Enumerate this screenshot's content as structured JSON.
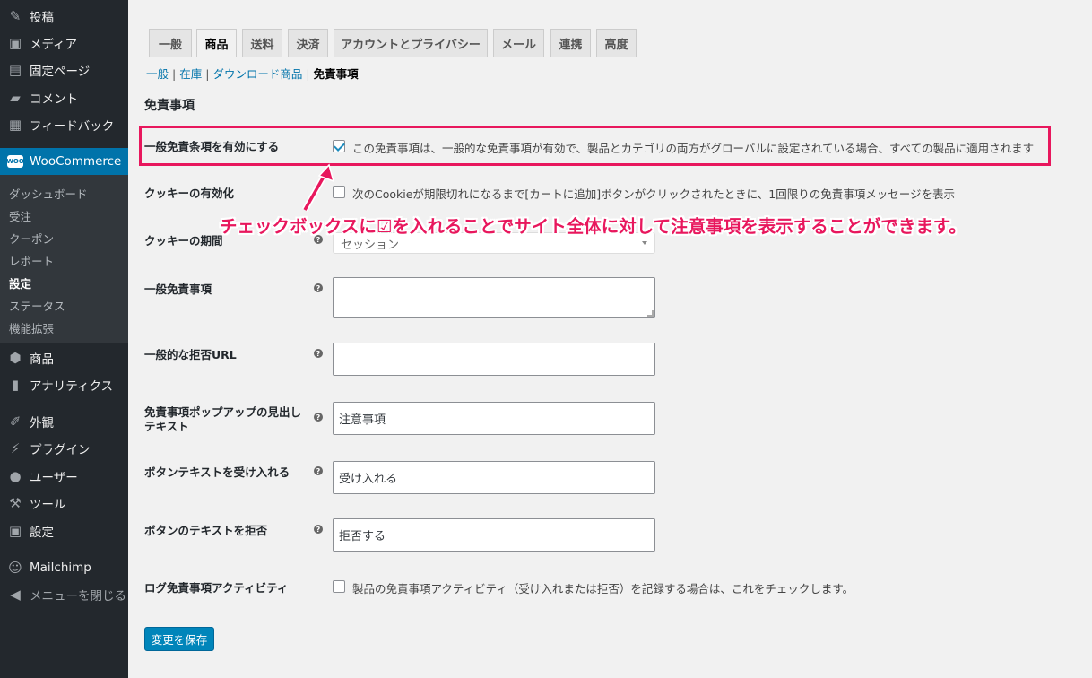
{
  "sidebar": {
    "items": [
      {
        "label": "投稿",
        "icon": "pin-icon"
      },
      {
        "label": "メディア",
        "icon": "media-icon"
      },
      {
        "label": "固定ページ",
        "icon": "page-icon"
      },
      {
        "label": "コメント",
        "icon": "comment-icon"
      },
      {
        "label": "フィードバック",
        "icon": "feedback-icon"
      },
      {
        "label": "WooCommerce",
        "icon": "woo-icon"
      },
      {
        "label": "商品",
        "icon": "product-icon"
      },
      {
        "label": "アナリティクス",
        "icon": "analytics-icon"
      },
      {
        "label": "外観",
        "icon": "appearance-icon"
      },
      {
        "label": "プラグイン",
        "icon": "plugin-icon"
      },
      {
        "label": "ユーザー",
        "icon": "user-icon"
      },
      {
        "label": "ツール",
        "icon": "tools-icon"
      },
      {
        "label": "設定",
        "icon": "settings-icon"
      },
      {
        "label": "Mailchimp",
        "icon": "mailchimp-icon"
      },
      {
        "label": "メニューを閉じる",
        "icon": "collapse-icon"
      }
    ],
    "woo_logo_text": "WOO",
    "submenu": [
      "ダッシュボード",
      "受注",
      "クーポン",
      "レポート",
      "設定",
      "ステータス",
      "機能拡張"
    ]
  },
  "tabs": [
    "一般",
    "商品",
    "送料",
    "決済",
    "アカウントとプライバシー",
    "メール",
    "連携",
    "高度"
  ],
  "subnav": {
    "links": [
      "一般",
      "在庫",
      "ダウンロード商品"
    ],
    "separator": "|",
    "current": "免責事項"
  },
  "section_title": "免責事項",
  "rows": {
    "enable": {
      "label": "一般免責条項を有効にする",
      "checked": true,
      "description": "この免責事項は、一般的な免責事項が有効で、製品とカテゴリの両方がグローバルに設定されている場合、すべての製品に適用されます"
    },
    "cookie": {
      "label": "クッキーの有効化",
      "checked": false,
      "description": "次のCookieが期限切れになるまで[カートに追加]ボタンがクリックされたときに、1回限りの免責事項メッセージを表示"
    },
    "cookie_period": {
      "label": "クッキーの期間",
      "value": "セッション"
    },
    "general_disclaimer": {
      "label": "一般免責事項",
      "value": ""
    },
    "reject_url": {
      "label": "一般的な拒否URL",
      "value": ""
    },
    "popup_heading": {
      "label_line1": "免責事項ポップアップの見出し",
      "label_line2": "テキスト",
      "value": "注意事項"
    },
    "accept_text": {
      "label": "ボタンテキストを受け入れる",
      "value": "受け入れる"
    },
    "reject_text": {
      "label": "ボタンのテキストを拒否",
      "value": "拒否する"
    },
    "log_activity": {
      "label": "ログ免責事項アクティビティ",
      "checked": false,
      "description": "製品の免責事項アクティビティ（受け入れまたは拒否）を記録する場合は、これをチェックします。"
    }
  },
  "help_glyph": "?",
  "save_button": "変更を保存",
  "annotation": {
    "text": "チェックボックスに☑を入れることでサイト全体に対して注意事項を表示することができます。",
    "color": "#e8175d"
  },
  "colors": {
    "accent": "#0073aa",
    "sidebar_bg": "#23282d",
    "button": "#0085ba"
  }
}
